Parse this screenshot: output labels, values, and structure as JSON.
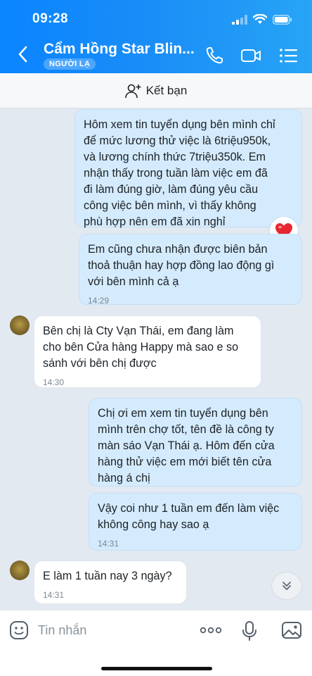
{
  "status_bar": {
    "time": "09:28"
  },
  "header": {
    "name": "Cẩm Hồng Star Blin...",
    "tag": "NGƯỜI LẠ"
  },
  "add_friend": {
    "label": "Kết bạn"
  },
  "messages": [
    {
      "side": "out",
      "text": "Hôm xem tin tuyển dụng bên mình chỉ\nđể mức lương thử việc là 6triệu950k,\nvà lương chính thức 7triệu350k. Em\nnhận thấy trong tuần làm việc em đã\nđi làm đúng giờ, làm đúng yêu cầu\ncông việc bên mình, vì thấy không\nphù hợp nên em đã xin nghỉ",
      "time": "",
      "reaction": "heart"
    },
    {
      "side": "out",
      "text": "Em cũng chưa nhận được biên bản\nthoả thuận hay hợp đồng lao động gì\nvới bên mình cả ạ",
      "time": "14:29"
    },
    {
      "side": "in",
      "text": "Bên chị là Cty Vạn Thái, em đang làm\ncho bên Cửa hàng Happy mà sao e so\nsánh với bên chị được",
      "time": "14:30"
    },
    {
      "side": "out",
      "text": "Chị ơi em xem tin tuyển dụng bên\nmình trên chợ tốt, tên đề là công ty\nmàn sáo Vạn Thái ạ. Hôm đến cửa\nhàng thử việc em mới biết tên cửa\nhàng á chị",
      "time": ""
    },
    {
      "side": "out",
      "text": "Vậy coi như 1 tuần em đến làm việc\nkhông công hay sao ạ",
      "time": "14:31"
    },
    {
      "side": "in",
      "text": "E làm 1 tuần nay 3 ngày?",
      "time": "14:31"
    }
  ],
  "input": {
    "placeholder": "Tin nhắn"
  },
  "colors": {
    "header": "#0a84ff",
    "outgoing_bubble": "#d4ebfd",
    "incoming_bubble": "#ffffff",
    "background": "#e2e9f1"
  }
}
